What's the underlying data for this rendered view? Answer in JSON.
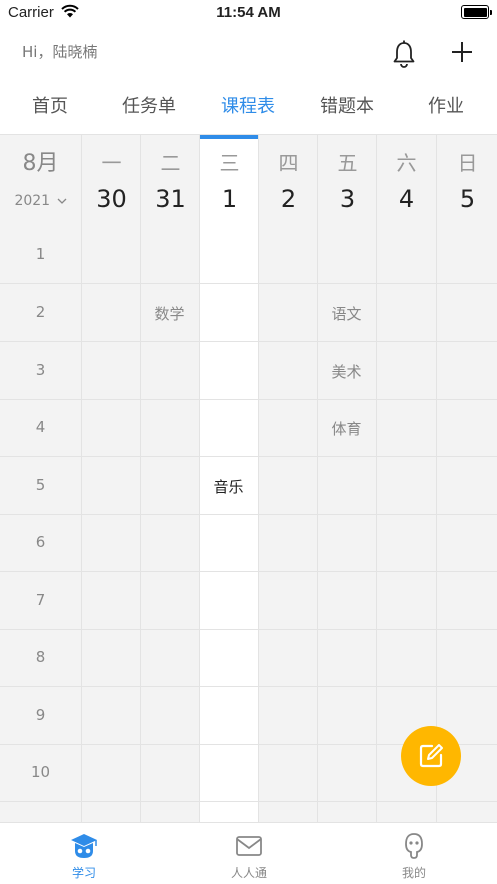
{
  "status_bar": {
    "carrier": "Carrier",
    "time": "11:54 AM"
  },
  "header": {
    "greeting": "Hi，陆晓楠"
  },
  "tabs": [
    {
      "label": "首页"
    },
    {
      "label": "任务单"
    },
    {
      "label": "课程表"
    },
    {
      "label": "错题本"
    },
    {
      "label": "作业"
    }
  ],
  "active_tab": "课程表",
  "calendar": {
    "month": "8月",
    "year": "2021",
    "days": [
      {
        "weekday": "一",
        "date": "30"
      },
      {
        "weekday": "二",
        "date": "31"
      },
      {
        "weekday": "三",
        "date": "1"
      },
      {
        "weekday": "四",
        "date": "2"
      },
      {
        "weekday": "五",
        "date": "3"
      },
      {
        "weekday": "六",
        "date": "4"
      },
      {
        "weekday": "日",
        "date": "5"
      }
    ],
    "periods": [
      "1",
      "2",
      "3",
      "4",
      "5",
      "6",
      "7",
      "8",
      "9",
      "10"
    ],
    "courses": {
      "tue_2": "数学",
      "fri_2": "语文",
      "fri_3": "美术",
      "fri_4": "体育",
      "wed_5": "音乐"
    }
  },
  "bottom_nav": [
    {
      "label": "学习",
      "icon": "graduation-cap-icon"
    },
    {
      "label": "人人通",
      "icon": "mail-icon"
    },
    {
      "label": "我的",
      "icon": "profile-icon"
    }
  ],
  "colors": {
    "accent": "#2F8CE8",
    "fab": "#FFB700",
    "grid_bg": "#f3f3f3"
  }
}
